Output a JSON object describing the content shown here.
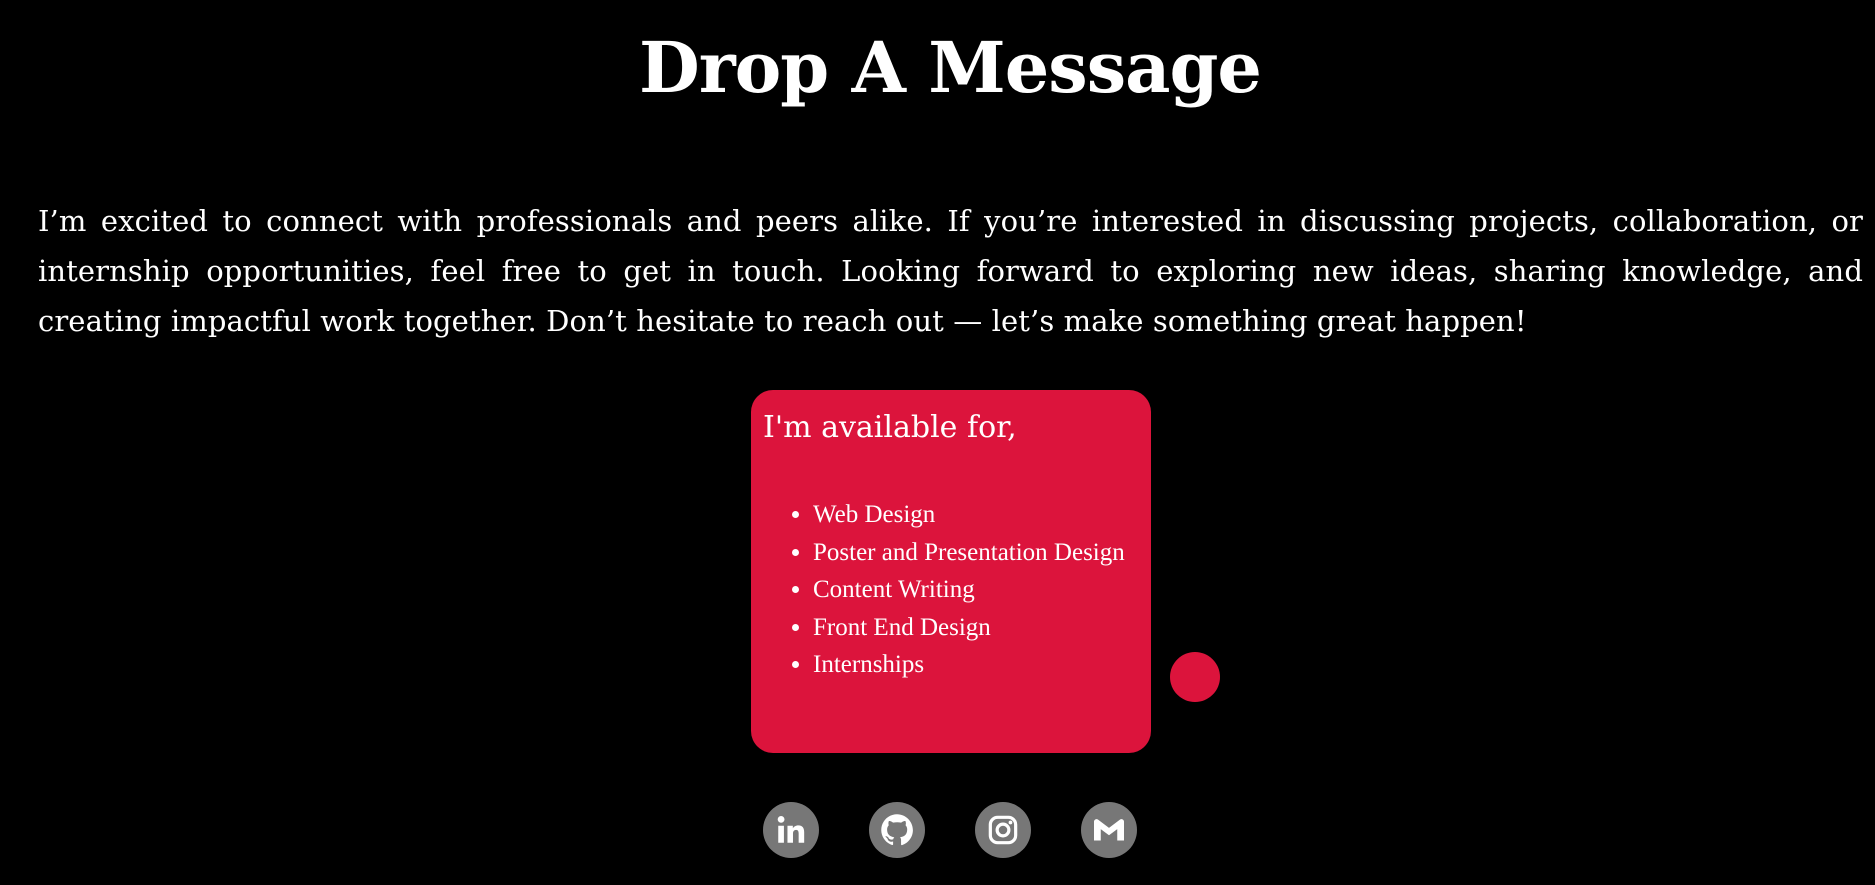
{
  "page": {
    "title": "Drop A Message",
    "intro": "I’m excited to connect with professionals and peers alike. If you’re interested in discussing projects, collaboration, or internship opportunities, feel free to get in touch. Looking forward to exploring new ideas, sharing knowledge, and creating impactful work together. Don’t hesitate to reach out — let’s make something great happen!"
  },
  "availability": {
    "heading": "I'm available for,",
    "items": [
      "Web Design",
      "Poster and Presentation Design",
      "Content Writing",
      "Front End Design",
      "Internships"
    ]
  },
  "social": {
    "links": [
      {
        "icon": "linkedin-icon"
      },
      {
        "icon": "github-icon"
      },
      {
        "icon": "instagram-icon"
      },
      {
        "icon": "gmail-icon"
      }
    ]
  },
  "colors": {
    "background": "#000000",
    "accent": "#dc143c",
    "social_circle": "#777777",
    "text": "#ffffff"
  }
}
